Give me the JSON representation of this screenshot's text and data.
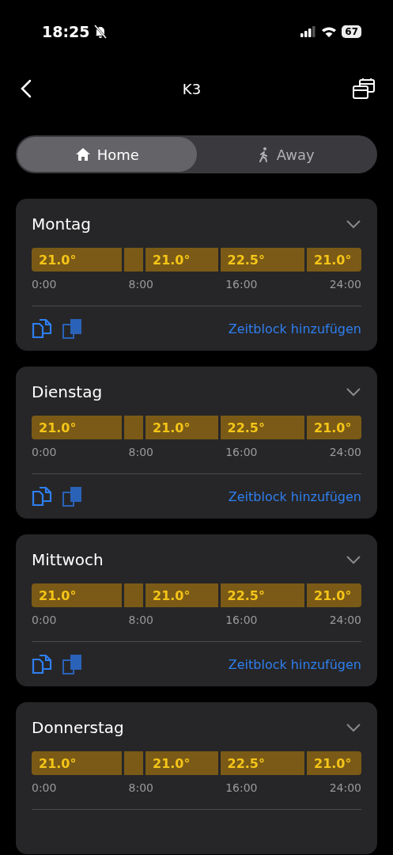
{
  "status_bar": {
    "time": "18:25",
    "battery": "67"
  },
  "header": {
    "title": "K3"
  },
  "modes": [
    {
      "label": "Home",
      "selected": true
    },
    {
      "label": "Away",
      "selected": false
    }
  ],
  "days": [
    {
      "name": "Montag",
      "expanded": false,
      "segments": [
        {
          "kind": "block",
          "temp": "21.0°"
        },
        {
          "kind": "short"
        },
        {
          "kind": "block",
          "temp": "21.0°"
        },
        {
          "kind": "block",
          "temp": "22.5°"
        },
        {
          "kind": "block",
          "temp": "21.0°"
        }
      ],
      "ticks": [
        "0:00",
        "8:00",
        "16:00",
        "24:00"
      ],
      "action": "Zeitblock hinzufügen"
    },
    {
      "name": "Dienstag",
      "expanded": false,
      "segments": [
        {
          "kind": "block",
          "temp": "21.0°"
        },
        {
          "kind": "short"
        },
        {
          "kind": "block",
          "temp": "21.0°"
        },
        {
          "kind": "block",
          "temp": "22.5°"
        },
        {
          "kind": "block",
          "temp": "21.0°"
        }
      ],
      "ticks": [
        "0:00",
        "8:00",
        "16:00",
        "24:00"
      ],
      "action": "Zeitblock hinzufügen"
    },
    {
      "name": "Mittwoch",
      "expanded": false,
      "segments": [
        {
          "kind": "block",
          "temp": "21.0°"
        },
        {
          "kind": "short"
        },
        {
          "kind": "block",
          "temp": "21.0°"
        },
        {
          "kind": "block",
          "temp": "22.5°"
        },
        {
          "kind": "block",
          "temp": "21.0°"
        }
      ],
      "ticks": [
        "0:00",
        "8:00",
        "16:00",
        "24:00"
      ],
      "action": "Zeitblock hinzufügen"
    },
    {
      "name": "Donnerstag",
      "expanded": false,
      "segments": [
        {
          "kind": "block",
          "temp": "21.0°"
        },
        {
          "kind": "short"
        },
        {
          "kind": "block",
          "temp": "21.0°"
        },
        {
          "kind": "block",
          "temp": "22.5°"
        },
        {
          "kind": "block",
          "temp": "21.0°"
        }
      ],
      "ticks": [
        "0:00",
        "8:00",
        "16:00",
        "24:00"
      ]
    }
  ]
}
